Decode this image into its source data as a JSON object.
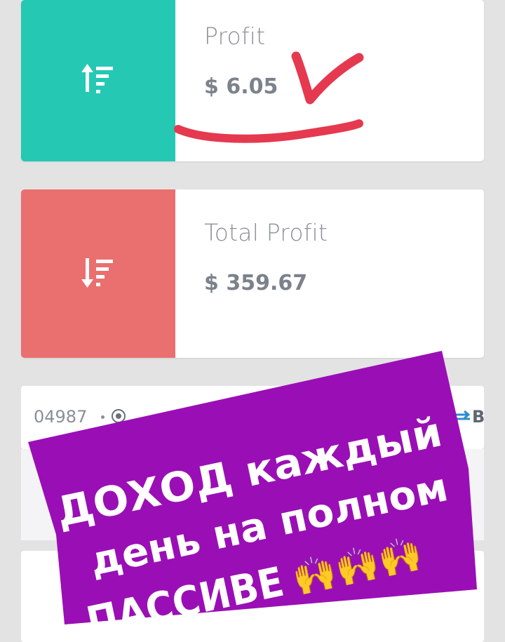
{
  "cards": {
    "profit": {
      "label": "Profit",
      "value": "$ 6.05",
      "icon": "sort-ascending-icon",
      "color": "#25c8b3"
    },
    "total_profit": {
      "label": "Total Profit",
      "value": "$ 359.67",
      "icon": "sort-descending-icon",
      "color": "#e9706e"
    }
  },
  "ticker": {
    "text": "04987",
    "suffix": "B"
  },
  "banner": {
    "line1": "ДОХОД каждый",
    "line2": "день на полном",
    "line3": "ПАССИВЕ",
    "emoji": "🙌🙌🙌",
    "background": "#9a0fb5"
  },
  "annotation": {
    "color": "#e53950"
  }
}
